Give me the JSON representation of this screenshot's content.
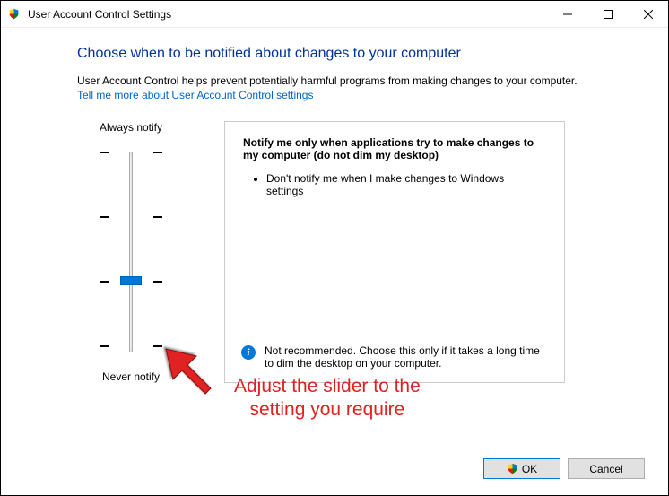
{
  "window": {
    "title": "User Account Control Settings"
  },
  "heading": "Choose when to be notified about changes to your computer",
  "description": "User Account Control helps prevent potentially harmful programs from making changes to your computer.",
  "help_link": "Tell me more about User Account Control settings",
  "slider": {
    "top_label": "Always notify",
    "bottom_label": "Never notify"
  },
  "info": {
    "title": "Notify me only when applications try to make changes to my computer (do not dim my desktop)",
    "bullet1": "Don't notify me when I make changes to Windows settings",
    "recommendation": "Not recommended. Choose this only if it takes a long time to dim the desktop on your computer."
  },
  "buttons": {
    "ok": "OK",
    "cancel": "Cancel"
  },
  "annotation": {
    "line1": "Adjust the slider to the",
    "line2": "setting you require"
  }
}
